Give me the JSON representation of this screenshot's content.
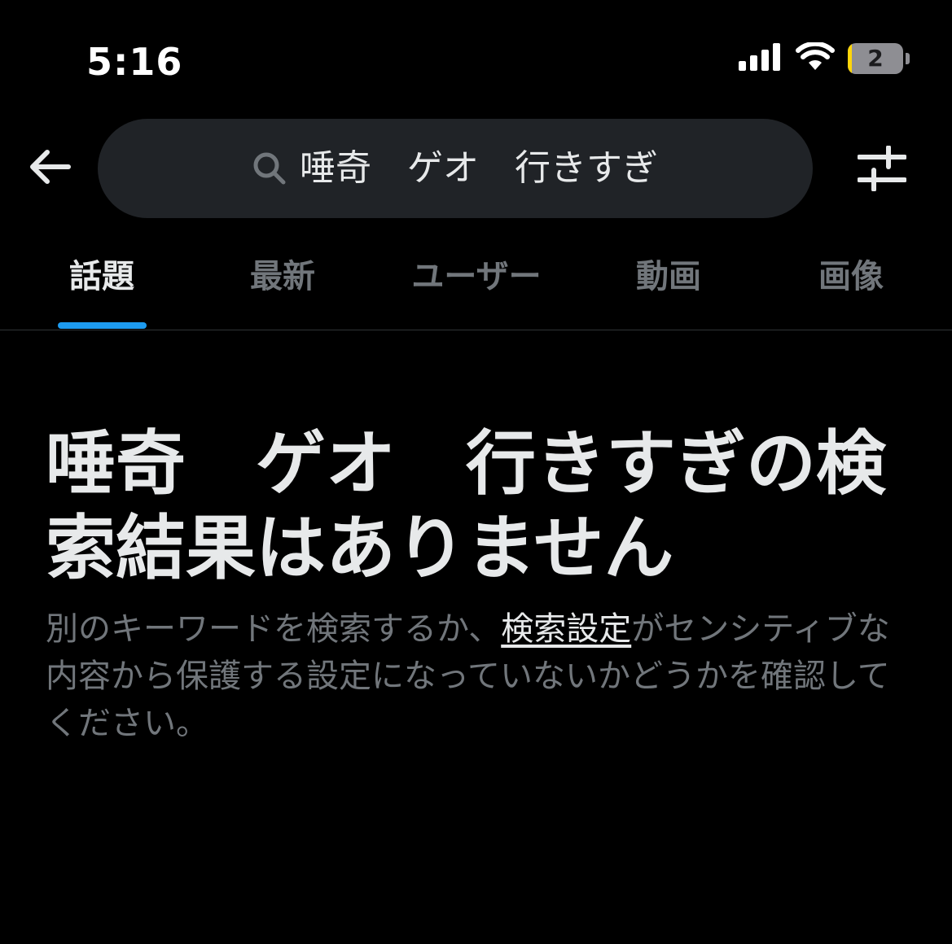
{
  "status_bar": {
    "time": "5:16",
    "battery_text": "2",
    "battery_level_percent": 8,
    "battery_fill_color": "#ffd60a"
  },
  "header": {
    "back_icon": "arrow-left-icon",
    "search_icon": "search-icon",
    "search_query": "唾奇　ゲオ　行きすぎ",
    "filter_icon": "sliders-icon"
  },
  "tabs": [
    {
      "label": "話題",
      "active": true
    },
    {
      "label": "最新",
      "active": false
    },
    {
      "label": "ユーザー",
      "active": false
    },
    {
      "label": "動画",
      "active": false
    },
    {
      "label": "画像",
      "active": false
    }
  ],
  "empty_state": {
    "title": "唾奇　ゲオ　行きすぎの検索結果はありません",
    "desc_before": "別のキーワードを検索するか、",
    "desc_link": "検索設定",
    "desc_after": "がセンシティブな内容から保護する設定になっていないかどうかを確認してください。"
  },
  "colors": {
    "background": "#000000",
    "accent": "#1d9bf0",
    "primary_text": "#e7e9ea",
    "secondary_text": "#71767b",
    "search_bg": "#202327"
  }
}
